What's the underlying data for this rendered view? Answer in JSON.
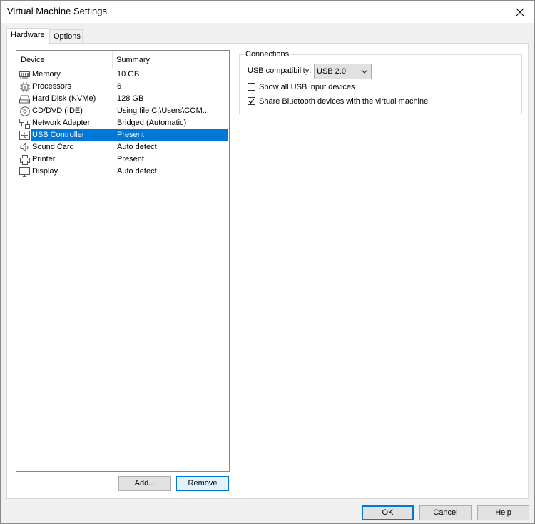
{
  "window": {
    "title": "Virtual Machine Settings"
  },
  "tabs": [
    {
      "label": "Hardware",
      "active": true
    },
    {
      "label": "Options",
      "active": false
    }
  ],
  "device_list": {
    "headers": {
      "device": "Device",
      "summary": "Summary"
    },
    "rows": [
      {
        "name": "Memory",
        "summary": "10 GB",
        "icon": "memory-icon"
      },
      {
        "name": "Processors",
        "summary": "6",
        "icon": "processor-icon"
      },
      {
        "name": "Hard Disk (NVMe)",
        "summary": "128 GB",
        "icon": "hard-disk-icon"
      },
      {
        "name": "CD/DVD (IDE)",
        "summary": "Using file C:\\Users\\COM...",
        "icon": "cd-dvd-icon"
      },
      {
        "name": "Network Adapter",
        "summary": "Bridged (Automatic)",
        "icon": "network-icon"
      },
      {
        "name": "USB Controller",
        "summary": "Present",
        "icon": "usb-icon",
        "selected": true
      },
      {
        "name": "Sound Card",
        "summary": "Auto detect",
        "icon": "speaker-icon"
      },
      {
        "name": "Printer",
        "summary": "Present",
        "icon": "printer-icon"
      },
      {
        "name": "Display",
        "summary": "Auto detect",
        "icon": "monitor-icon"
      }
    ]
  },
  "list_buttons": {
    "add": "Add...",
    "remove": "Remove"
  },
  "connections": {
    "legend": "Connections",
    "usb_compat_label": "USB compatibility:",
    "usb_compat_value": "USB 2.0",
    "show_all_label": "Show all USB input devices",
    "show_all_checked": false,
    "share_bt_label": "Share Bluetooth devices with the virtual machine",
    "share_bt_checked": true
  },
  "footer": {
    "ok": "OK",
    "cancel": "Cancel",
    "help": "Help"
  },
  "colors": {
    "selection": "#0078d7",
    "window_bg": "#f0f0f0",
    "panel_bg": "#ffffff"
  }
}
